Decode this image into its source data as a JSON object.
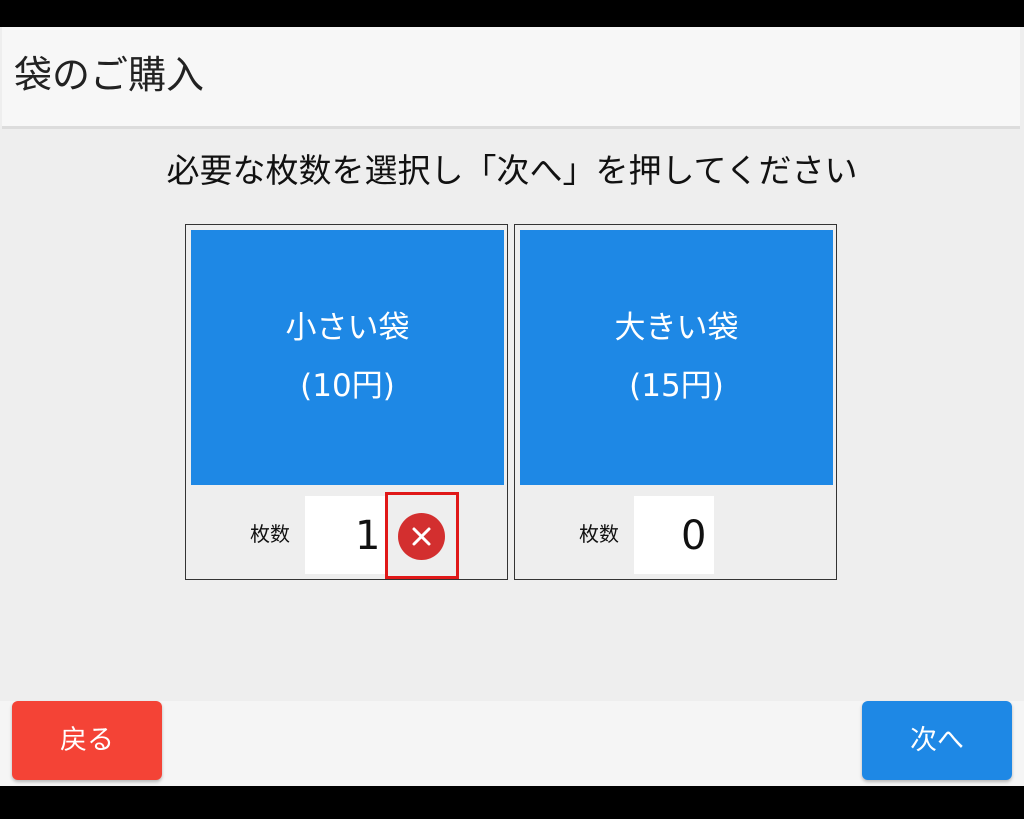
{
  "header": {
    "title": "袋のご購入"
  },
  "instruction": "必要な枚数を選択し「次へ」を押してください",
  "bags": [
    {
      "name": "小さい袋",
      "price": "(10円)",
      "qty_label": "枚数",
      "quantity": "1"
    },
    {
      "name": "大きい袋",
      "price": "(15円)",
      "qty_label": "枚数",
      "quantity": "0"
    }
  ],
  "footer": {
    "back_label": "戻る",
    "next_label": "次へ"
  },
  "icons": {
    "clear": "clear-x-icon"
  },
  "colors": {
    "primary": "#1e88e5",
    "danger": "#f44336",
    "clear_icon": "#d32f2f",
    "highlight": "#e01818"
  }
}
